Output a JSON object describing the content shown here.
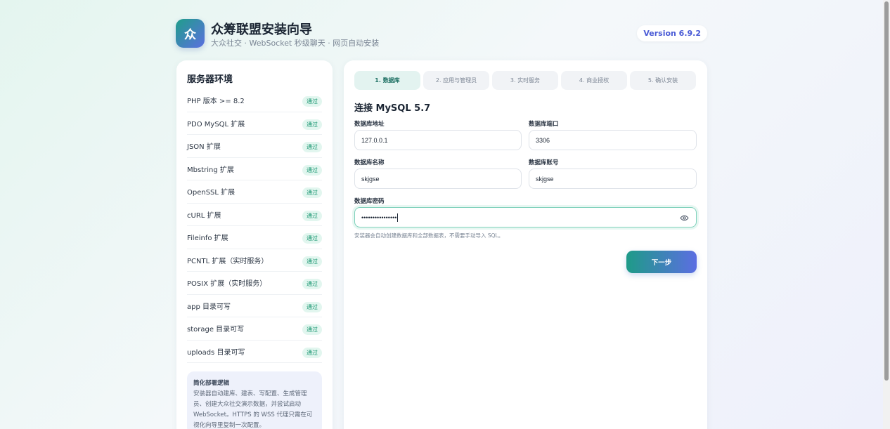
{
  "header": {
    "logo_text": "众",
    "title": "众筹联盟安装向导",
    "subtitle": "大众社交 · WebSocket 秒级聊天 · 网页自动安装",
    "version": "Version 6.9.2"
  },
  "environment": {
    "title": "服务器环境",
    "checks": [
      {
        "label": "PHP 版本 >= 8.2",
        "status": "通过"
      },
      {
        "label": "PDO MySQL 扩展",
        "status": "通过"
      },
      {
        "label": "JSON 扩展",
        "status": "通过"
      },
      {
        "label": "Mbstring 扩展",
        "status": "通过"
      },
      {
        "label": "OpenSSL 扩展",
        "status": "通过"
      },
      {
        "label": "cURL 扩展",
        "status": "通过"
      },
      {
        "label": "Fileinfo 扩展",
        "status": "通过"
      },
      {
        "label": "PCNTL 扩展（实时服务）",
        "status": "通过"
      },
      {
        "label": "POSIX 扩展（实时服务）",
        "status": "通过"
      },
      {
        "label": "app 目录可写",
        "status": "通过"
      },
      {
        "label": "storage 目录可写",
        "status": "通过"
      },
      {
        "label": "uploads 目录可写",
        "status": "通过"
      }
    ],
    "note": {
      "title": "简化部署逻辑",
      "body": "安装器自动建库、建表、写配置、生成管理员、创建大众社交演示数据，并尝试启动 WebSocket。HTTPS 的 WSS 代理只需在可视化向导里复制一次配置。"
    }
  },
  "wizard": {
    "steps": [
      {
        "label": "1. 数据库",
        "active": true
      },
      {
        "label": "2. 应用与管理员",
        "active": false
      },
      {
        "label": "3. 实时服务",
        "active": false
      },
      {
        "label": "4. 商业授权",
        "active": false
      },
      {
        "label": "5. 确认安装",
        "active": false
      }
    ],
    "section_title": "连接 MySQL 5.7",
    "fields": {
      "db_host": {
        "label": "数据库地址",
        "value": "127.0.0.1"
      },
      "db_port": {
        "label": "数据库端口",
        "value": "3306"
      },
      "db_name": {
        "label": "数据库名称",
        "value": "skjgse"
      },
      "db_user": {
        "label": "数据库账号",
        "value": "skjgse"
      },
      "db_password": {
        "label": "数据库密码",
        "value": "••••••••••••••••"
      }
    },
    "hint": "安装器会自动创建数据库和全部数据表，不需要手动导入 SQL。",
    "next_label": "下一步"
  },
  "icons": {
    "password_toggle": "eye-icon"
  },
  "colors": {
    "accent_teal": "#1e9b88",
    "accent_indigo": "#5c6ee2",
    "pass_green": "#16956f",
    "version_text": "#4a5bd6"
  }
}
